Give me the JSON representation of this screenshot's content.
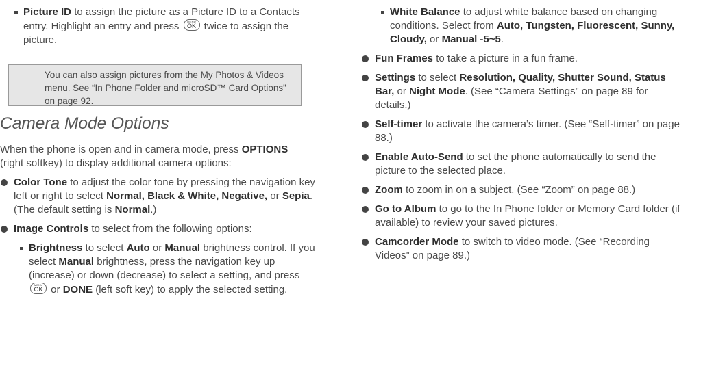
{
  "left": {
    "picture_id": {
      "term": "Picture ID",
      "text1": " to assign the picture as a Picture ID to a Contacts entry. Highlight an entry and press ",
      "text2": " twice to assign the picture."
    },
    "note": "You can also assign pictures from the My Photos & Videos menu. See “In Phone Folder and microSD™ Card Options” on page 92.",
    "heading": "Camera Mode Options",
    "intro": {
      "text1": "When the phone is open and in camera mode, press ",
      "options": "OPTIONS",
      "text2": " (right softkey) to display additional camera options:"
    },
    "color_tone": {
      "term": "Color Tone",
      "text1": " to adjust the color tone by pressing the navigation key left or right to select ",
      "opts": "Normal, Black & White, Negative,",
      "text2": " or ",
      "sepia": "Sepia",
      "text3": ". (The default setting is ",
      "normal": "Normal",
      "text4": ".)"
    },
    "image_controls": {
      "term": "Image Controls",
      "text": " to select from the following options:"
    },
    "brightness": {
      "term": "Brightness",
      "text1": " to select ",
      "auto": "Auto",
      "text2": " or ",
      "manual": "Manual",
      "text3": " brightness control. If you select ",
      "manual2": "Manual",
      "text4": " brightness, press the navigation key up (increase) or down (decrease) to select a setting, and press ",
      "text5": " or ",
      "done": "DONE",
      "text6": " (left soft key) to apply the selected setting."
    }
  },
  "right": {
    "white_balance": {
      "term": "White Balance",
      "text1": " to adjust white balance based on changing conditions. Select from ",
      "opts": "Auto, Tungsten, Fluorescent, Sunny, Cloudy,",
      "text2": " or ",
      "manual": "Manual -5~5",
      "text3": "."
    },
    "fun_frames": {
      "term": "Fun Frames",
      "text": " to take a picture in a fun frame."
    },
    "settings": {
      "term": "Settings",
      "text1": " to select ",
      "opts": "Resolution, Quality, Shutter Sound, Status Bar,",
      "text2": " or ",
      "night": "Night Mode",
      "text3": ". (See “Camera Settings” on page 89 for details.)"
    },
    "self_timer": {
      "term": "Self-timer",
      "text": " to activate the camera’s timer. (See “Self-timer” on page 88.)"
    },
    "auto_send": {
      "term": "Enable Auto-Send",
      "text": " to set the phone automatically to send the picture to the selected place."
    },
    "zoom": {
      "term": "Zoom",
      "text": " to zoom in on a subject. (See “Zoom” on page 88.)"
    },
    "album": {
      "term": "Go to Album",
      "text": " to go to the In Phone folder or Memory Card folder (if available) to review your saved pictures."
    },
    "camcorder": {
      "term": "Camcorder Mode",
      "text": " to switch to video mode. (See “Recording Videos” on page 89.)"
    }
  },
  "ok_key": {
    "menu": "MENU",
    "ok": "OK"
  }
}
